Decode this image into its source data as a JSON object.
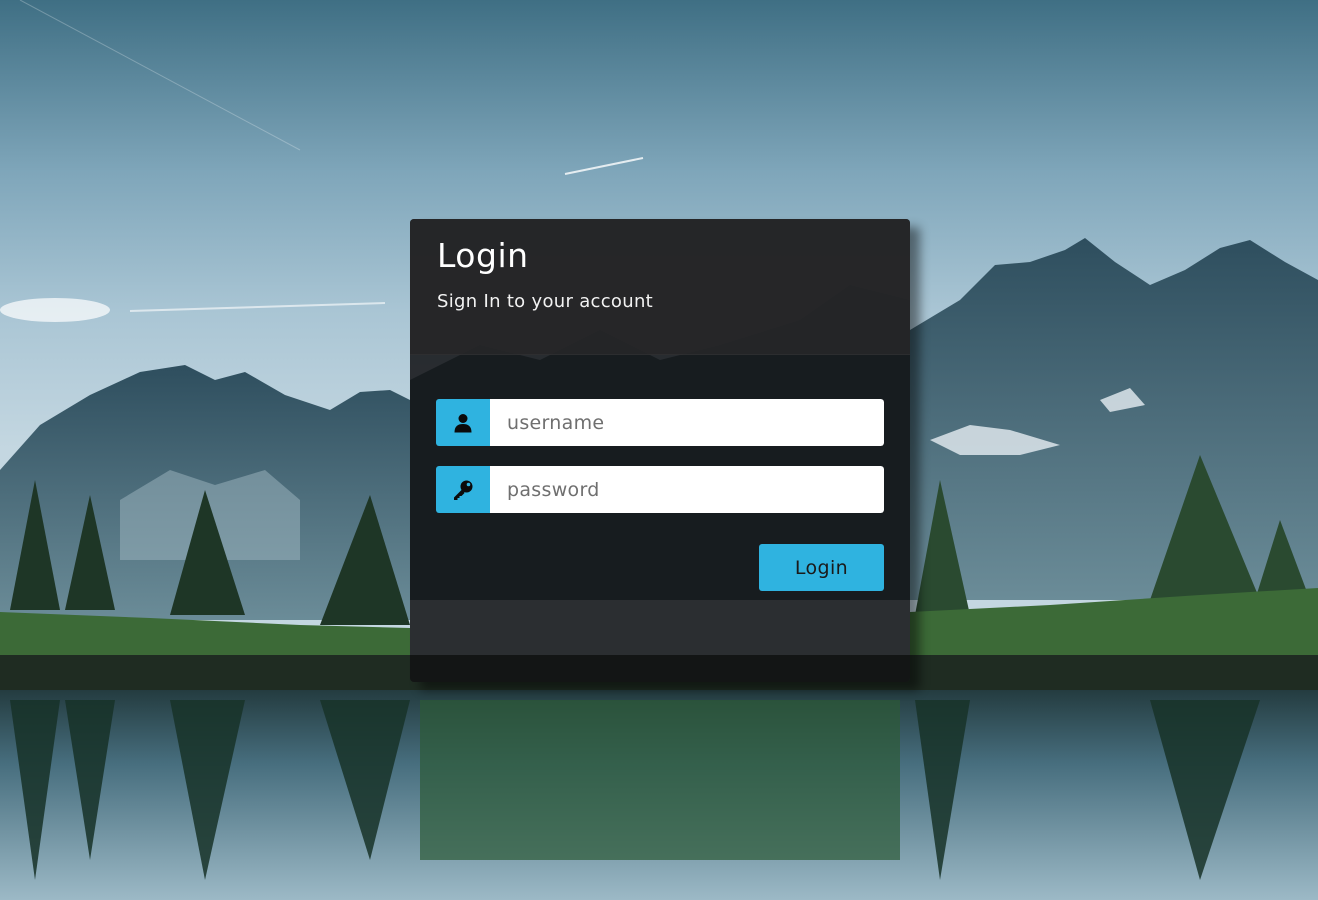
{
  "login_card": {
    "title": "Login",
    "subtitle": "Sign In to your account",
    "username": {
      "icon": "user-icon",
      "value": "",
      "placeholder": "username"
    },
    "password": {
      "icon": "key-icon",
      "value": "",
      "placeholder": "password"
    },
    "submit_label": "Login"
  },
  "colors": {
    "accent": "#2fb3e0",
    "card_background": "#121214",
    "header_background": "#262628"
  }
}
